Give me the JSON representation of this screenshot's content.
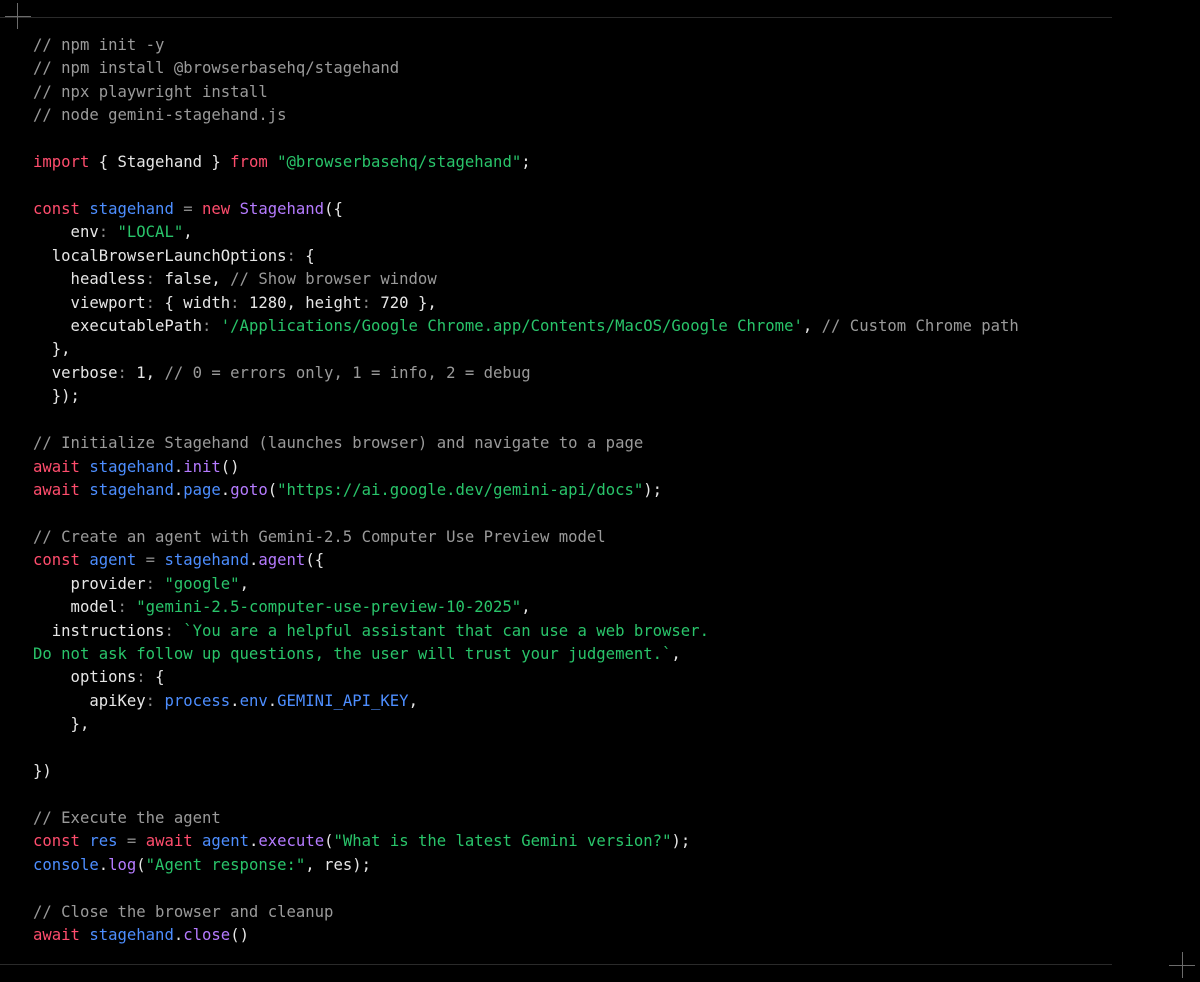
{
  "colors": {
    "background": "#000000",
    "plain": "#e6e6e6",
    "comment": "#9a9a9a",
    "keyword": "#ff4d6d",
    "string": "#29c46a",
    "identifier": "#4d8eff",
    "class_name": "#b57bff",
    "punctuation": "#8a8a8a"
  },
  "code": {
    "language": "javascript",
    "lines": [
      [
        {
          "t": "// npm init -y",
          "k": "comment"
        }
      ],
      [
        {
          "t": "// npm install @browserbasehq/stagehand",
          "k": "comment"
        }
      ],
      [
        {
          "t": "// npx playwright install",
          "k": "comment"
        }
      ],
      [
        {
          "t": "// node gemini-stagehand.js",
          "k": "comment"
        }
      ],
      [],
      [
        {
          "t": "import",
          "k": "keyword"
        },
        {
          "t": " { Stagehand } ",
          "k": "plain"
        },
        {
          "t": "from",
          "k": "keyword"
        },
        {
          "t": " ",
          "k": "plain"
        },
        {
          "t": "\"@browserbasehq/stagehand\"",
          "k": "string"
        },
        {
          "t": ";",
          "k": "plain"
        }
      ],
      [],
      [
        {
          "t": "const",
          "k": "keyword"
        },
        {
          "t": " ",
          "k": "plain"
        },
        {
          "t": "stagehand",
          "k": "identifier"
        },
        {
          "t": " = ",
          "k": "punct"
        },
        {
          "t": "new",
          "k": "keyword"
        },
        {
          "t": " ",
          "k": "plain"
        },
        {
          "t": "Stagehand",
          "k": "class"
        },
        {
          "t": "({",
          "k": "plain"
        }
      ],
      [
        {
          "t": "    env",
          "k": "plain"
        },
        {
          "t": ": ",
          "k": "punct"
        },
        {
          "t": "\"LOCAL\"",
          "k": "string"
        },
        {
          "t": ",",
          "k": "plain"
        }
      ],
      [
        {
          "t": "  localBrowserLaunchOptions",
          "k": "plain"
        },
        {
          "t": ": ",
          "k": "punct"
        },
        {
          "t": "{",
          "k": "plain"
        }
      ],
      [
        {
          "t": "    headless",
          "k": "plain"
        },
        {
          "t": ": ",
          "k": "punct"
        },
        {
          "t": "false, ",
          "k": "plain"
        },
        {
          "t": "// Show browser window",
          "k": "comment"
        }
      ],
      [
        {
          "t": "    viewport",
          "k": "plain"
        },
        {
          "t": ": ",
          "k": "punct"
        },
        {
          "t": "{ width",
          "k": "plain"
        },
        {
          "t": ": ",
          "k": "punct"
        },
        {
          "t": "1280, height",
          "k": "plain"
        },
        {
          "t": ": ",
          "k": "punct"
        },
        {
          "t": "720 },",
          "k": "plain"
        }
      ],
      [
        {
          "t": "    executablePath",
          "k": "plain"
        },
        {
          "t": ": ",
          "k": "punct"
        },
        {
          "t": "'/Applications/Google Chrome.app/Contents/MacOS/Google Chrome'",
          "k": "string"
        },
        {
          "t": ", ",
          "k": "plain"
        },
        {
          "t": "// Custom Chrome path",
          "k": "comment"
        }
      ],
      [
        {
          "t": "  },",
          "k": "plain"
        }
      ],
      [
        {
          "t": "  verbose",
          "k": "plain"
        },
        {
          "t": ": ",
          "k": "punct"
        },
        {
          "t": "1, ",
          "k": "plain"
        },
        {
          "t": "// 0 = errors only, 1 = info, 2 = debug",
          "k": "comment"
        }
      ],
      [
        {
          "t": "  });",
          "k": "plain"
        }
      ],
      [],
      [
        {
          "t": "// Initialize Stagehand (launches browser) and navigate to a page",
          "k": "comment"
        }
      ],
      [
        {
          "t": "await",
          "k": "keyword"
        },
        {
          "t": " ",
          "k": "plain"
        },
        {
          "t": "stagehand",
          "k": "identifier"
        },
        {
          "t": ".",
          "k": "plain"
        },
        {
          "t": "init",
          "k": "class"
        },
        {
          "t": "()",
          "k": "plain"
        }
      ],
      [
        {
          "t": "await",
          "k": "keyword"
        },
        {
          "t": " ",
          "k": "plain"
        },
        {
          "t": "stagehand",
          "k": "identifier"
        },
        {
          "t": ".",
          "k": "plain"
        },
        {
          "t": "page",
          "k": "identifier"
        },
        {
          "t": ".",
          "k": "plain"
        },
        {
          "t": "goto",
          "k": "class"
        },
        {
          "t": "(",
          "k": "plain"
        },
        {
          "t": "\"https://ai.google.dev/gemini-api/docs\"",
          "k": "string"
        },
        {
          "t": ");",
          "k": "plain"
        }
      ],
      [],
      [
        {
          "t": "// Create an agent with Gemini-2.5 Computer Use Preview model",
          "k": "comment"
        }
      ],
      [
        {
          "t": "const",
          "k": "keyword"
        },
        {
          "t": " ",
          "k": "plain"
        },
        {
          "t": "agent",
          "k": "identifier"
        },
        {
          "t": " = ",
          "k": "punct"
        },
        {
          "t": "stagehand",
          "k": "identifier"
        },
        {
          "t": ".",
          "k": "plain"
        },
        {
          "t": "agent",
          "k": "class"
        },
        {
          "t": "({",
          "k": "plain"
        }
      ],
      [
        {
          "t": "    provider",
          "k": "plain"
        },
        {
          "t": ": ",
          "k": "punct"
        },
        {
          "t": "\"google\"",
          "k": "string"
        },
        {
          "t": ",",
          "k": "plain"
        }
      ],
      [
        {
          "t": "    model",
          "k": "plain"
        },
        {
          "t": ": ",
          "k": "punct"
        },
        {
          "t": "\"gemini-2.5-computer-use-preview-10-2025\"",
          "k": "string"
        },
        {
          "t": ",",
          "k": "plain"
        }
      ],
      [
        {
          "t": "  instructions",
          "k": "plain"
        },
        {
          "t": ": ",
          "k": "punct"
        },
        {
          "t": "`You are a helpful assistant that can use a web browser.",
          "k": "string"
        }
      ],
      [
        {
          "t": "Do not ask follow up questions, the user will trust your judgement.`",
          "k": "string"
        },
        {
          "t": ",",
          "k": "plain"
        }
      ],
      [
        {
          "t": "    options",
          "k": "plain"
        },
        {
          "t": ": ",
          "k": "punct"
        },
        {
          "t": "{",
          "k": "plain"
        }
      ],
      [
        {
          "t": "      apiKey",
          "k": "plain"
        },
        {
          "t": ": ",
          "k": "punct"
        },
        {
          "t": "process",
          "k": "identifier"
        },
        {
          "t": ".",
          "k": "plain"
        },
        {
          "t": "env",
          "k": "identifier"
        },
        {
          "t": ".",
          "k": "plain"
        },
        {
          "t": "GEMINI_API_KEY",
          "k": "identifier"
        },
        {
          "t": ",",
          "k": "plain"
        }
      ],
      [
        {
          "t": "    },",
          "k": "plain"
        }
      ],
      [],
      [
        {
          "t": "})",
          "k": "plain"
        }
      ],
      [],
      [
        {
          "t": "// Execute the agent",
          "k": "comment"
        }
      ],
      [
        {
          "t": "const",
          "k": "keyword"
        },
        {
          "t": " ",
          "k": "plain"
        },
        {
          "t": "res",
          "k": "identifier"
        },
        {
          "t": " = ",
          "k": "punct"
        },
        {
          "t": "await",
          "k": "keyword"
        },
        {
          "t": " ",
          "k": "plain"
        },
        {
          "t": "agent",
          "k": "identifier"
        },
        {
          "t": ".",
          "k": "plain"
        },
        {
          "t": "execute",
          "k": "class"
        },
        {
          "t": "(",
          "k": "plain"
        },
        {
          "t": "\"What is the latest Gemini version?\"",
          "k": "string"
        },
        {
          "t": ");",
          "k": "plain"
        }
      ],
      [
        {
          "t": "console",
          "k": "identifier"
        },
        {
          "t": ".",
          "k": "plain"
        },
        {
          "t": "log",
          "k": "class"
        },
        {
          "t": "(",
          "k": "plain"
        },
        {
          "t": "\"Agent response:\"",
          "k": "string"
        },
        {
          "t": ", res);",
          "k": "plain"
        }
      ],
      [],
      [
        {
          "t": "// Close the browser and cleanup",
          "k": "comment"
        }
      ],
      [
        {
          "t": "await",
          "k": "keyword"
        },
        {
          "t": " ",
          "k": "plain"
        },
        {
          "t": "stagehand",
          "k": "identifier"
        },
        {
          "t": ".",
          "k": "plain"
        },
        {
          "t": "close",
          "k": "class"
        },
        {
          "t": "()",
          "k": "plain"
        }
      ]
    ]
  }
}
